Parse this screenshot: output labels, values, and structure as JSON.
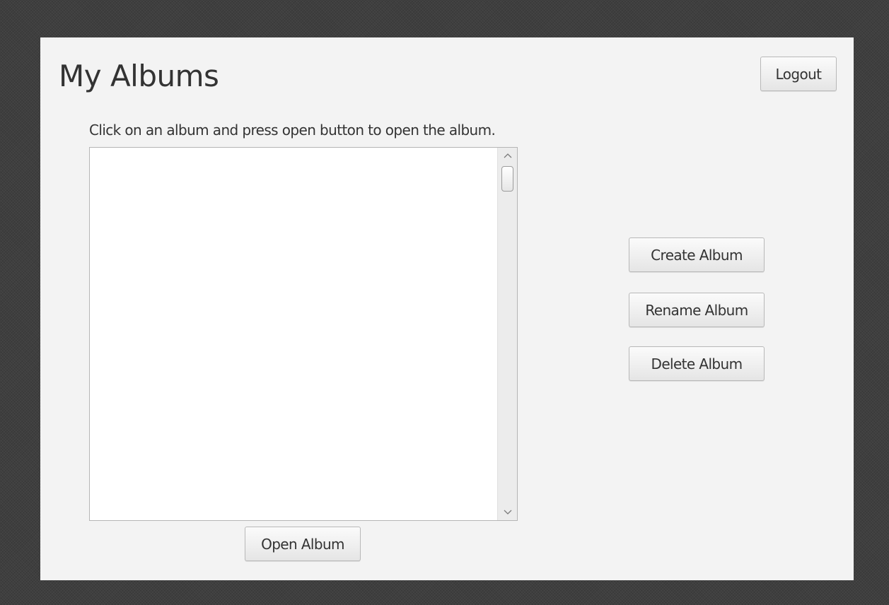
{
  "page": {
    "title": "My Albums",
    "instructions": "Click on an album and press open button to open the album."
  },
  "buttons": {
    "logout": "Logout",
    "create_album": "Create Album",
    "rename_album": "Rename Album",
    "delete_album": "Delete Album",
    "open_album": "Open Album"
  },
  "album_list": {
    "items": []
  },
  "icons": {
    "scroll_up": "chevron-up-icon",
    "scroll_down": "chevron-down-icon"
  },
  "colors": {
    "window_background": "#f3f3f3",
    "desktop_background": "#3f3f3f",
    "text": "#333333",
    "list_background": "#ffffff"
  }
}
